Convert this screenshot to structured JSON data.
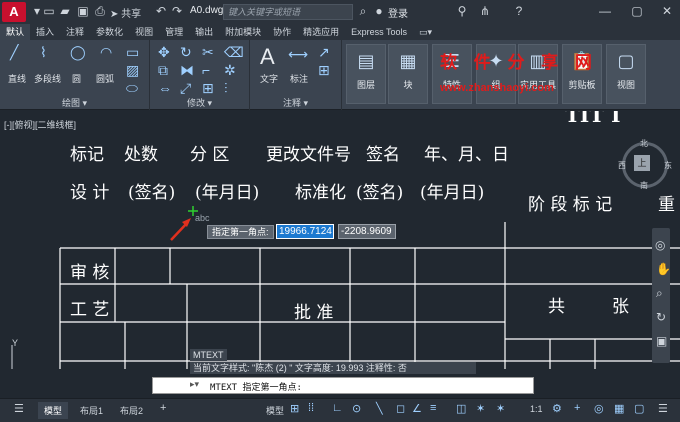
{
  "titlebar": {
    "app_logo": "A",
    "share_label": "共享",
    "doc_title": "A0.dwg",
    "search_placeholder": "键入关键字或短语",
    "login_label": "登录",
    "help_icon": "?"
  },
  "ribbon_tabs": [
    "默认",
    "插入",
    "注释",
    "参数化",
    "视图",
    "管理",
    "输出",
    "附加模块",
    "协作",
    "精选应用",
    "Express Tools"
  ],
  "ribbon": {
    "draw": {
      "group_label": "绘图",
      "line_label": "直线",
      "polyline_label": "多段线",
      "circle_label": "圆",
      "arc_label": "圆弧"
    },
    "modify": {
      "group_label": "修改"
    },
    "annotation": {
      "group_label": "注释",
      "text_label": "文字",
      "dim_label": "标注"
    },
    "buttons": {
      "layer": "图层",
      "block": "块",
      "properties": "特性",
      "group": "组",
      "utilities": "实用工具",
      "clipboard": "剪贴板",
      "view": "视图"
    },
    "watermark": "软 件 分 享 网",
    "watermark_url": "www.zhanshaoyi.com"
  },
  "view_label": "[-][俯视][二维线框]",
  "title_block": {
    "r1": [
      "标记",
      "处数",
      "分 区",
      "更改文件号",
      "签名",
      "年、月、日"
    ],
    "r2": [
      "设 计",
      "(签名)",
      "(年月日)",
      "标准化",
      "(签名)",
      "(年月日)"
    ],
    "stage": "阶 段 标 记",
    "weight": "重",
    "review": "审 核",
    "process": "工 艺",
    "approve": "批 准",
    "total": "共",
    "sheets": "张",
    "top_right": "TIT I"
  },
  "viewcube": {
    "north": "北",
    "west": "西",
    "east": "东",
    "south": "南",
    "top": "上"
  },
  "prompt": {
    "tooltip": "指定第一角点:",
    "x_value": "19966.7124",
    "y_value": "-2208.9609",
    "abc": "abc"
  },
  "command": {
    "tag": "MTEXT",
    "history": "当前文字样式: \"陈杰 (2) \"  文字高度: 19.993  注释性: 否",
    "line": "MTEXT 指定第一角点:"
  },
  "statusbar": {
    "tabs": [
      "模型",
      "布局1",
      "布局2"
    ],
    "model_label": "模型",
    "scale": "1:1"
  }
}
